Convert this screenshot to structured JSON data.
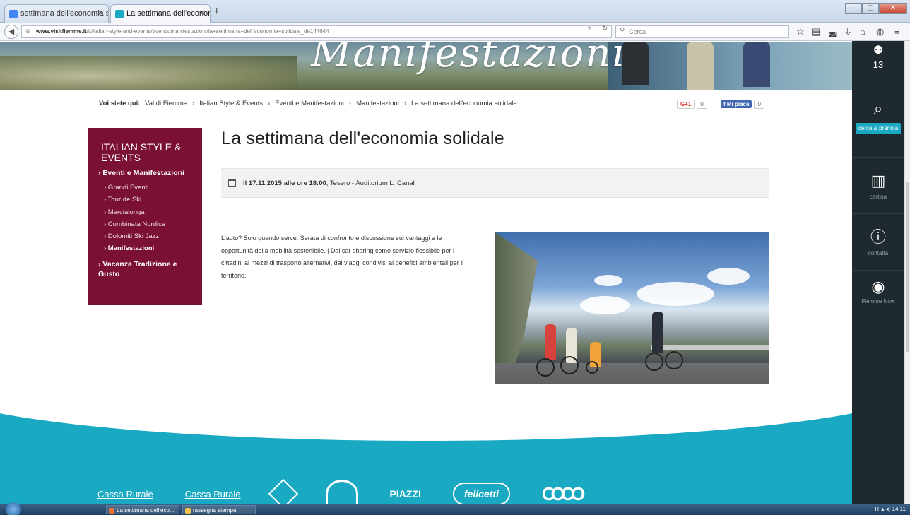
{
  "browser": {
    "tabs": [
      {
        "label": "settimana dell'economia s...",
        "active": false,
        "favicon_color": "#4285f4"
      },
      {
        "label": "La settimana dell'economi...",
        "active": true,
        "favicon_color": "#1aa9c2"
      }
    ],
    "url_host": "www.visitfiemme.it",
    "url_path": "/it/italian-style-and-events/events/manifestazioni/la+settimana+dell'economia+solidale_de144644",
    "search_placeholder": "Cerca"
  },
  "hero": {
    "title": "Manifestazioni"
  },
  "breadcrumb": {
    "lead": "Voi siete qui:",
    "items": [
      "Val di Fiemme",
      "Italian Style & Events",
      "Eventi e Manifestazioni",
      "Manifestazioni",
      "La settimana dell'economia solidale"
    ]
  },
  "social": {
    "gplus_label": "G+1",
    "gplus_count": "0",
    "fb_label": "Mi piace",
    "fb_count": "0"
  },
  "sidemenu": {
    "category": "ITALIAN STYLE & EVENTS",
    "section": "› Eventi e Manifestazioni",
    "items": [
      "› Grandi Eventi",
      "› Tour de Ski",
      "› Marcialonga",
      "› Combinata Nordica",
      "› Dolomiti Ski Jazz",
      "› Manifestazioni"
    ],
    "current_index": 5,
    "section2": "› Vacanza Tradizione e Gusto"
  },
  "event": {
    "title": "La settimana dell'economia solidale",
    "date_label": "Il 17.11.2015 alle ore 18:00",
    "location": ", Tesero - Auditorium L. Canal",
    "description": "L'auto? Solo quando serve. Serata di confronto e discussione sui vantaggi e le opportunità della mobilità sostenibile. | Dal car sharing come servizio flessibile per i cittadini ai mezzi di trasporto alternativi, dai viaggi condivisi ai benefici ambientali per il territorio."
  },
  "footer": {
    "sponsors": [
      "Cassa Rurale",
      "Cassa Rurale",
      "",
      "",
      "PIAZZI",
      "felicetti",
      "COOO"
    ]
  },
  "rightbar": {
    "weather_temp": "13",
    "search_cta": "cerca & prenota",
    "map_label": "cartina",
    "contact_label": "contatta",
    "now_label": "Fiemme Now"
  },
  "taskbar": {
    "tasks": [
      "La settimana dell'eco...",
      "rassegna stampa"
    ],
    "lang": "IT",
    "time": "14:11"
  },
  "colors": {
    "brand_maroon": "#7a1035",
    "accent_teal": "#1aa9c2",
    "sidebar_dark": "#1e2a30"
  }
}
